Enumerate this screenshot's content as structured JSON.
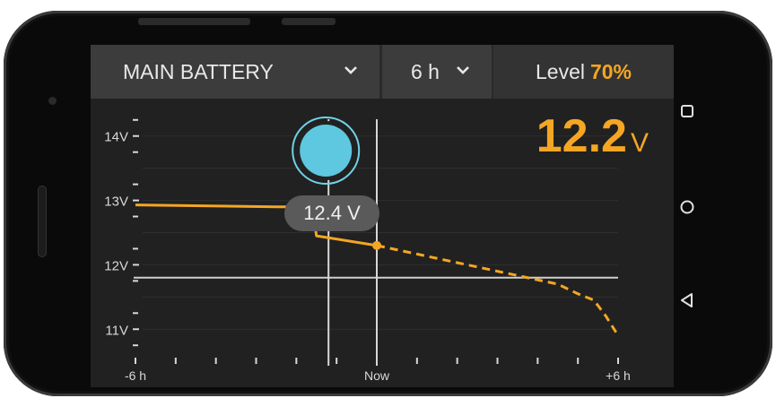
{
  "header": {
    "source_label": "MAIN BATTERY",
    "range_label": "6 h",
    "level_label": "Level",
    "level_value": "70%"
  },
  "readout": {
    "value": "12.2",
    "unit": "V"
  },
  "tooltip": {
    "text": "12.4 V"
  },
  "chart_data": {
    "type": "line",
    "xlabel": "",
    "ylabel": "",
    "x_tick_labels": [
      "-6 h",
      "Now",
      "+6 h"
    ],
    "y_tick_labels": [
      "14V",
      "13V",
      "12V",
      "11V"
    ],
    "xlim": [
      -6,
      6
    ],
    "ylim": [
      10.6,
      14.4
    ],
    "series": [
      {
        "style": "solid",
        "color": "#f5a623",
        "x": [
          -6,
          -2.5,
          -1.6,
          -1.5,
          0
        ],
        "y": [
          12.93,
          12.9,
          12.9,
          12.45,
          12.3
        ]
      },
      {
        "style": "dashed",
        "color": "#f5a623",
        "x": [
          0,
          1.5,
          3,
          4.5,
          5.0,
          5.4,
          5.7,
          6.0
        ],
        "y": [
          12.3,
          12.1,
          11.9,
          11.7,
          11.55,
          11.45,
          11.2,
          10.9
        ]
      }
    ],
    "current_point": {
      "x": 0,
      "y": 12.3
    },
    "threshold": 11.8,
    "cursor_x": -1.2,
    "grid": true
  }
}
